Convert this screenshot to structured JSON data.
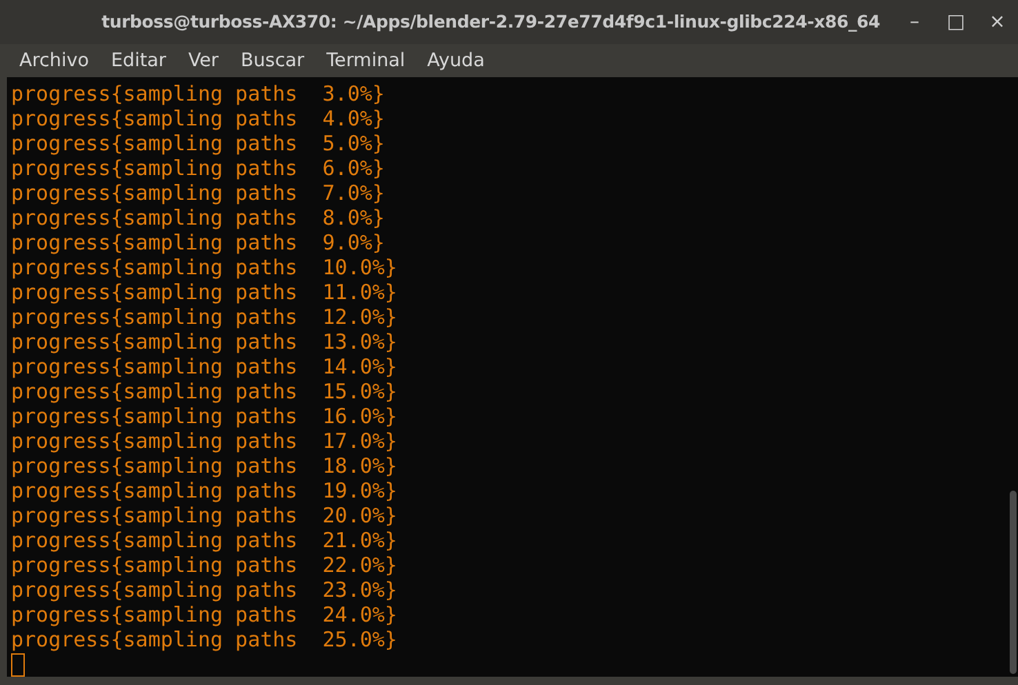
{
  "window": {
    "title": "turboss@turboss-AX370: ~/Apps/blender-2.79-27e77d4f9c1-linux-glibc224-x86_64",
    "controls": [
      "–",
      "□",
      "×"
    ]
  },
  "menu": [
    "Archivo",
    "Editar",
    "Ver",
    "Buscar",
    "Terminal",
    "Ayuda"
  ],
  "terminal": {
    "lines": [
      "progress{sampling paths  3.0%}",
      "progress{sampling paths  4.0%}",
      "progress{sampling paths  5.0%}",
      "progress{sampling paths  6.0%}",
      "progress{sampling paths  7.0%}",
      "progress{sampling paths  8.0%}",
      "progress{sampling paths  9.0%}",
      "progress{sampling paths  10.0%}",
      "progress{sampling paths  11.0%}",
      "progress{sampling paths  12.0%}",
      "progress{sampling paths  13.0%}",
      "progress{sampling paths  14.0%}",
      "progress{sampling paths  15.0%}",
      "progress{sampling paths  16.0%}",
      "progress{sampling paths  17.0%}",
      "progress{sampling paths  18.0%}",
      "progress{sampling paths  19.0%}",
      "progress{sampling paths  20.0%}",
      "progress{sampling paths  21.0%}",
      "progress{sampling paths  22.0%}",
      "progress{sampling paths  23.0%}",
      "progress{sampling paths  24.0%}",
      "progress{sampling paths  25.0%}"
    ]
  }
}
